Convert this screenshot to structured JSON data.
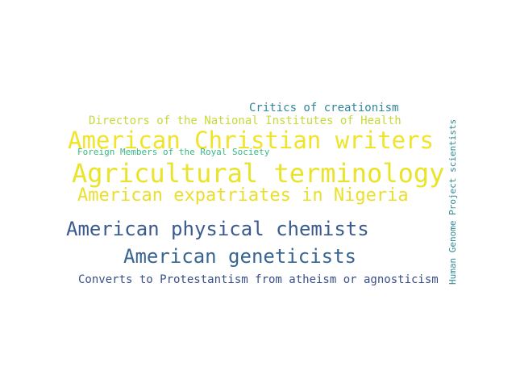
{
  "words": [
    {
      "text": "Critics of creationism",
      "color": "#31859c"
    },
    {
      "text": "Directors of the National Institutes of Health",
      "color": "#c8d93a"
    },
    {
      "text": "American Christian writers",
      "color": "#f1e329"
    },
    {
      "text": "Foreign Members of the Royal Society",
      "color": "#3bb785"
    },
    {
      "text": "Agricultural terminology",
      "color": "#e9e32a"
    },
    {
      "text": "American expatriates in Nigeria",
      "color": "#ecdf2b"
    },
    {
      "text": "American physical chemists",
      "color": "#3b5b8e"
    },
    {
      "text": "American geneticists",
      "color": "#386591"
    },
    {
      "text": "Converts to Protestantism from atheism or agnosticism",
      "color": "#3a4f89"
    },
    {
      "text": "Human Genome Project scientists",
      "color": "#2f8b94"
    }
  ]
}
